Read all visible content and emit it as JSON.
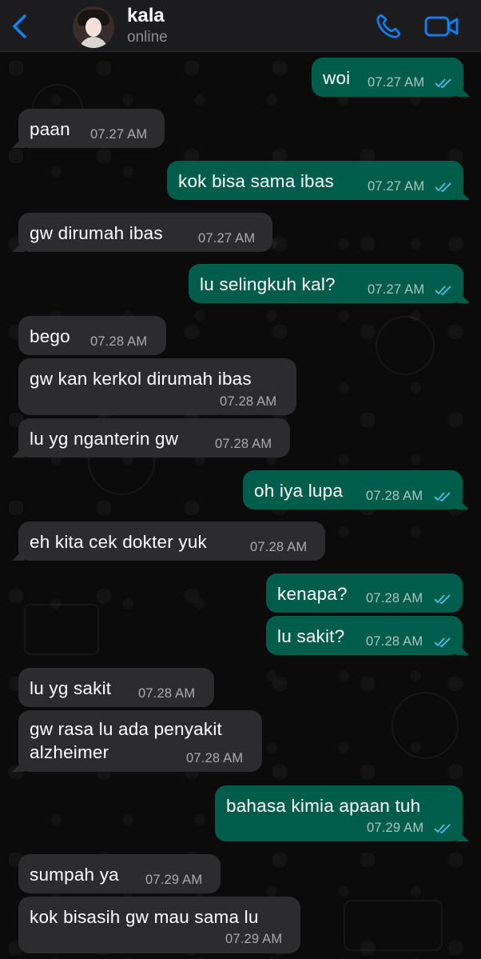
{
  "header": {
    "contact_name": "kala",
    "status": "online",
    "accent": "#0a84ff"
  },
  "colors": {
    "incoming": "#2c2c2e",
    "outgoing": "#005c4b",
    "read_tick": "#53bdeb"
  },
  "messages": [
    {
      "dir": "out",
      "text": "woi",
      "time": "07.27 AM",
      "read": true
    },
    {
      "dir": "in",
      "text": "paan",
      "time": "07.27 AM"
    },
    {
      "dir": "out",
      "text": "kok bisa sama ibas",
      "time": "07.27 AM",
      "read": true
    },
    {
      "dir": "in",
      "text": "gw dirumah ibas",
      "time": "07.27 AM"
    },
    {
      "dir": "out",
      "text": "lu selingkuh kal?",
      "time": "07.27 AM",
      "read": true
    },
    {
      "dir": "in",
      "text": "bego",
      "time": "07.28 AM"
    },
    {
      "dir": "in",
      "text": "gw kan kerkol dirumah ibas",
      "time": "07.28 AM"
    },
    {
      "dir": "in",
      "text": "lu yg nganterin gw",
      "time": "07.28 AM"
    },
    {
      "dir": "out",
      "text": "oh iya lupa",
      "time": "07.28 AM",
      "read": true
    },
    {
      "dir": "in",
      "text": "eh kita cek dokter yuk",
      "time": "07.28 AM"
    },
    {
      "dir": "out",
      "text": "kenapa?",
      "time": "07.28 AM",
      "read": true
    },
    {
      "dir": "out",
      "text": "lu sakit?",
      "time": "07.28 AM",
      "read": true
    },
    {
      "dir": "in",
      "text": "lu yg sakit",
      "time": "07.28 AM"
    },
    {
      "dir": "in",
      "text": "gw rasa lu ada penyakit alzheimer",
      "time": "07.28 AM"
    },
    {
      "dir": "out",
      "text": "bahasa kimia apaan tuh",
      "time": "07.29 AM",
      "read": true
    },
    {
      "dir": "in",
      "text": "sumpah ya",
      "time": "07.29 AM"
    },
    {
      "dir": "in",
      "text": "kok bisasih gw mau sama lu",
      "time": "07.29 AM"
    }
  ]
}
